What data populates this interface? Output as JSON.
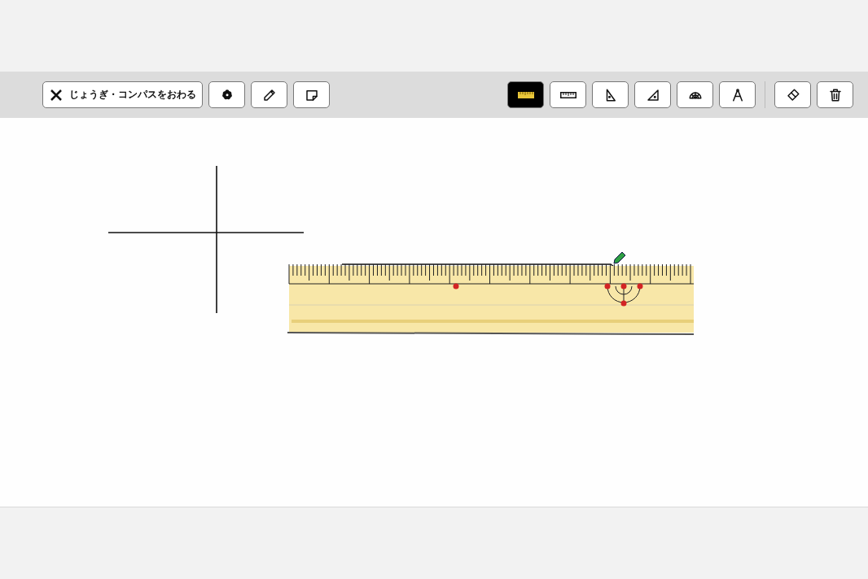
{
  "exit_button": {
    "label": "じょうぎ・コンパスをおわる"
  },
  "left_tools": [
    {
      "kind": "flower",
      "selected": false
    },
    {
      "kind": "pencil",
      "selected": false
    },
    {
      "kind": "note",
      "selected": false
    }
  ],
  "drawing_tools": [
    {
      "kind": "yellow-ruler",
      "selected": true
    },
    {
      "kind": "ruler",
      "selected": false
    },
    {
      "kind": "triangle",
      "selected": false
    },
    {
      "kind": "set-square",
      "selected": false
    },
    {
      "kind": "protractor",
      "selected": false
    },
    {
      "kind": "compass",
      "selected": false
    }
  ],
  "edit_tools": [
    {
      "kind": "eraser",
      "selected": false
    },
    {
      "kind": "trash",
      "selected": false
    }
  ]
}
